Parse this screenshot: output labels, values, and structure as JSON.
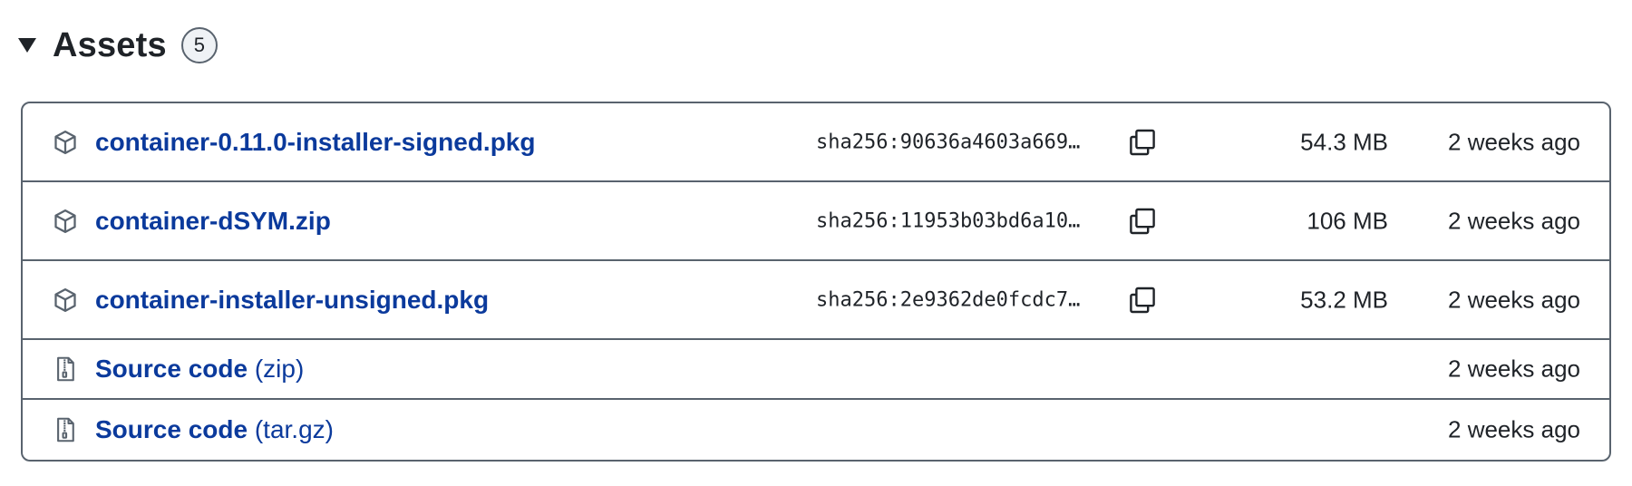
{
  "header": {
    "title": "Assets",
    "count": "5"
  },
  "assets": [
    {
      "name": "container-0.11.0-installer-signed.pkg",
      "sha": "sha256:90636a4603a669…",
      "size": "54.3 MB",
      "date": "2 weeks ago",
      "icon": "package-icon"
    },
    {
      "name": "container-dSYM.zip",
      "sha": "sha256:11953b03bd6a10…",
      "size": "106 MB",
      "date": "2 weeks ago",
      "icon": "package-icon"
    },
    {
      "name": "container-installer-unsigned.pkg",
      "sha": "sha256:2e9362de0fcdc7…",
      "size": "53.2 MB",
      "date": "2 weeks ago",
      "icon": "package-icon"
    }
  ],
  "source": [
    {
      "label": "Source code",
      "suffix": "(zip)",
      "date": "2 weeks ago",
      "icon": "file-zip-icon"
    },
    {
      "label": "Source code",
      "suffix": "(tar.gz)",
      "date": "2 weeks ago",
      "icon": "file-zip-icon"
    }
  ],
  "colors": {
    "link": "#0b3a9c",
    "border": "#59636e",
    "text": "#1f2328"
  }
}
